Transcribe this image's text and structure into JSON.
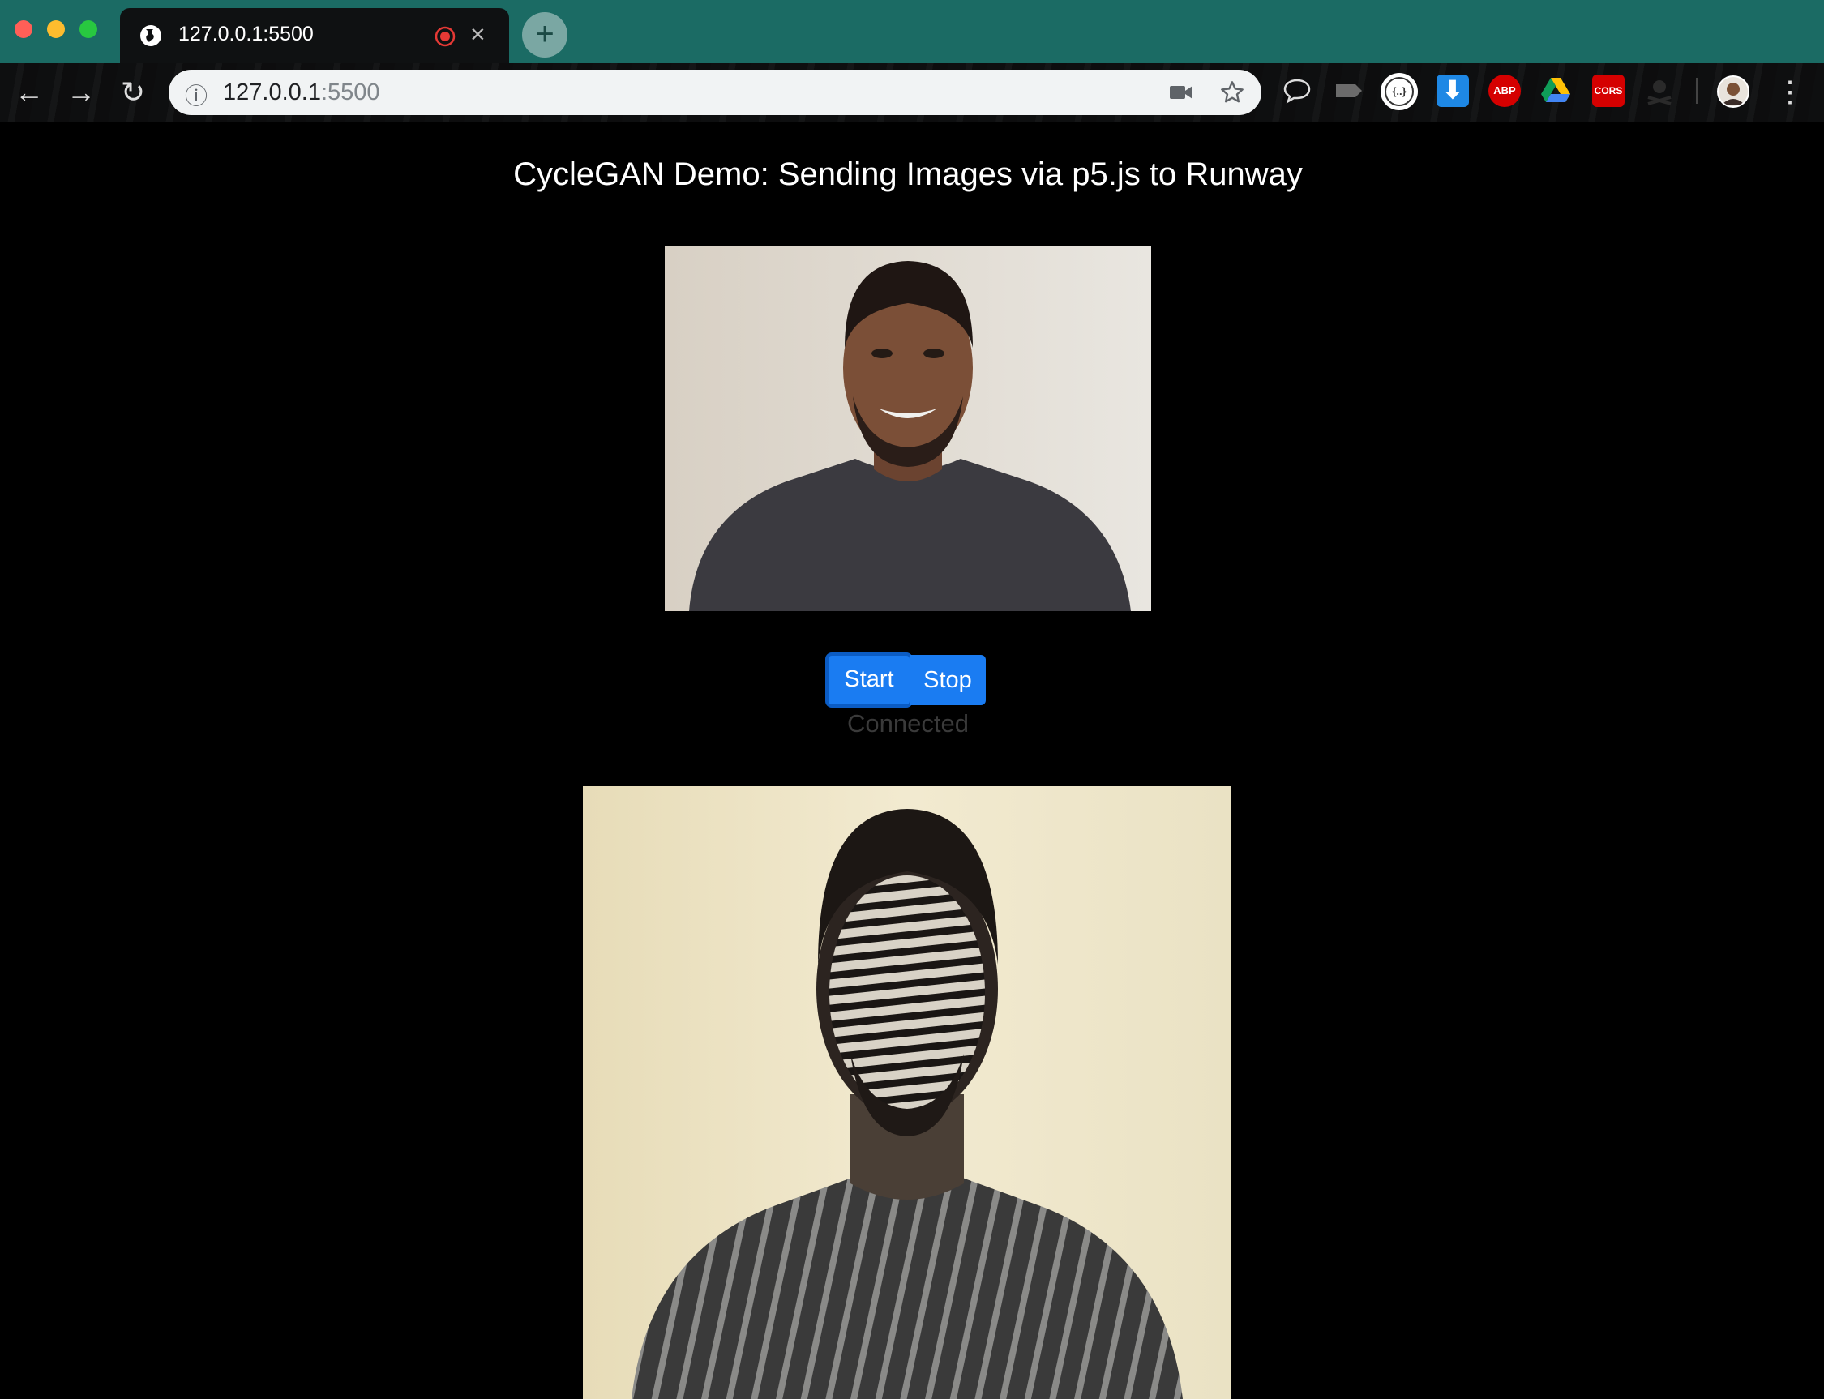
{
  "browser": {
    "tab": {
      "title": "127.0.0.1:5500",
      "close": "×"
    },
    "new_tab": "+",
    "nav": {
      "back": "←",
      "forward": "→",
      "reload": "↻"
    },
    "address": {
      "host": "127.0.0.1",
      "port": ":5500",
      "info": "ⓘ"
    },
    "extensions": [
      {
        "name": "speech-bubble-icon",
        "label": ""
      },
      {
        "name": "tag-icon",
        "label": ""
      },
      {
        "name": "json-formatter-icon",
        "label": "{..}"
      },
      {
        "name": "download-icon",
        "label": "⬇"
      },
      {
        "name": "adblock-icon",
        "label": "ABP"
      },
      {
        "name": "google-drive-icon",
        "label": ""
      },
      {
        "name": "cors-icon",
        "label": "CORS"
      },
      {
        "name": "pirate-icon",
        "label": ""
      }
    ],
    "menu": "⋮"
  },
  "page": {
    "title": "CycleGAN Demo: Sending Images via p5.js to Runway",
    "buttons": {
      "start": "Start",
      "stop": "Stop"
    },
    "status": "Connected"
  },
  "colors": {
    "tab_bar": "#1b6b64",
    "button": "#1a7cf2",
    "page_bg": "#000000",
    "status_text": "#3a3a3a"
  }
}
